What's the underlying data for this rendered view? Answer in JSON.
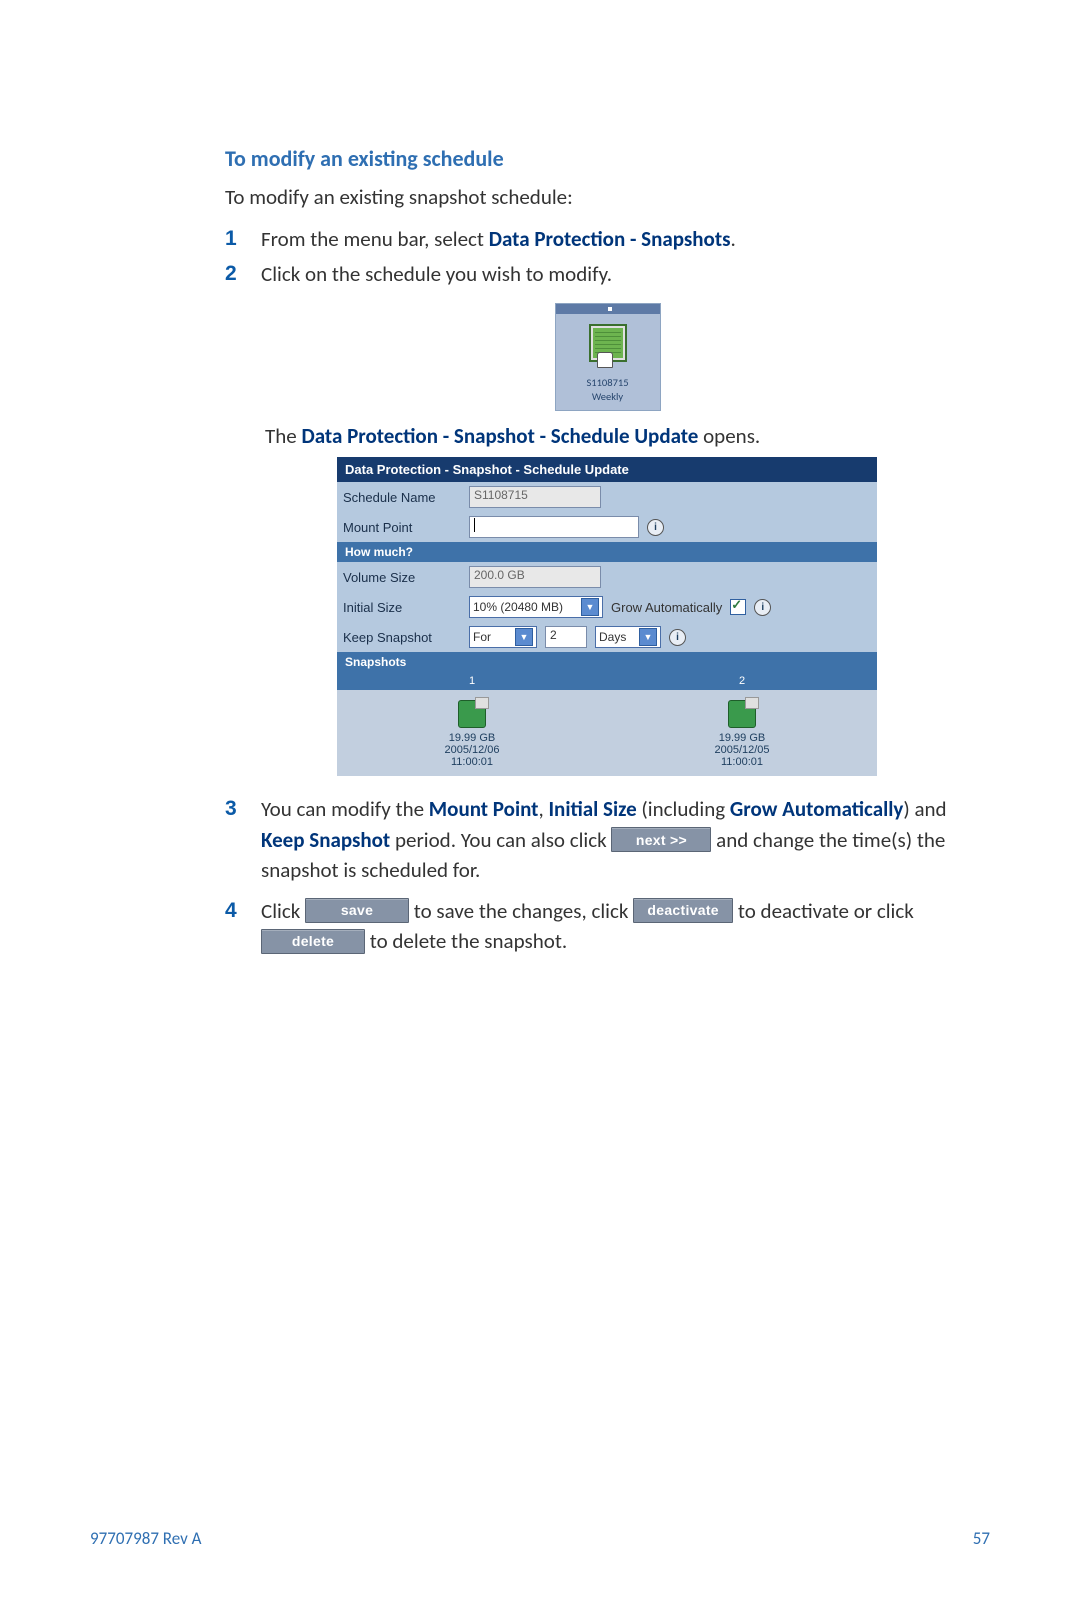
{
  "heading": "To modify an existing schedule",
  "intro": "To modify an existing snapshot schedule:",
  "step1_pre": "From the menu bar, select ",
  "step1_bold": "Data Protection - Snapshots",
  "step1_post": ".",
  "step2": "Click on the schedule you wish to modify.",
  "fig1_text1": "S1108715",
  "fig1_text2": "Weekly",
  "opens_pre": "The ",
  "opens_bold": "Data Protection - Snapshot - Schedule Update",
  "opens_post": " opens.",
  "panel": {
    "title": "Data Protection - Snapshot - Schedule Update",
    "schedule_name_label": "Schedule Name",
    "schedule_name_value": "S1108715",
    "mount_point_label": "Mount Point",
    "mount_point_value": "",
    "how_much": "How much?",
    "volume_size_label": "Volume Size",
    "volume_size_value": "200.0 GB",
    "initial_size_label": "Initial Size",
    "initial_size_value": "10% (20480 MB)",
    "grow_auto_label": "Grow Automatically",
    "keep_snapshot_label": "Keep Snapshot",
    "keep_for": "For",
    "keep_value": "2",
    "keep_unit": "Days",
    "snapshots_label": "Snapshots",
    "col1": "1",
    "col2": "2",
    "snap1_size": "19.99 GB",
    "snap1_date": "2005/12/06",
    "snap1_time": "11:00:01",
    "snap2_size": "19.99 GB",
    "snap2_date": "2005/12/05",
    "snap2_time": "11:00:01"
  },
  "step3_a": "You can modify the ",
  "step3_b1": "Mount Point",
  "step3_c": ", ",
  "step3_b2": "Initial Size",
  "step3_d": " (including ",
  "step3_b3": "Grow Automatically",
  "step3_e": ") and ",
  "step3_b4": "Keep Snapshot",
  "step3_f": " period. You can also click ",
  "btn_next": "next >>",
  "step3_g": " and change the time(s) the snapshot is scheduled for.",
  "step4_a": "Click ",
  "btn_save": "save",
  "step4_b": " to save the changes, click ",
  "btn_deactivate": "deactivate",
  "step4_c": " to deactivate or click ",
  "btn_delete": "delete",
  "step4_d": " to delete the snapshot.",
  "footer_left": "97707987 Rev A",
  "footer_right": "57"
}
